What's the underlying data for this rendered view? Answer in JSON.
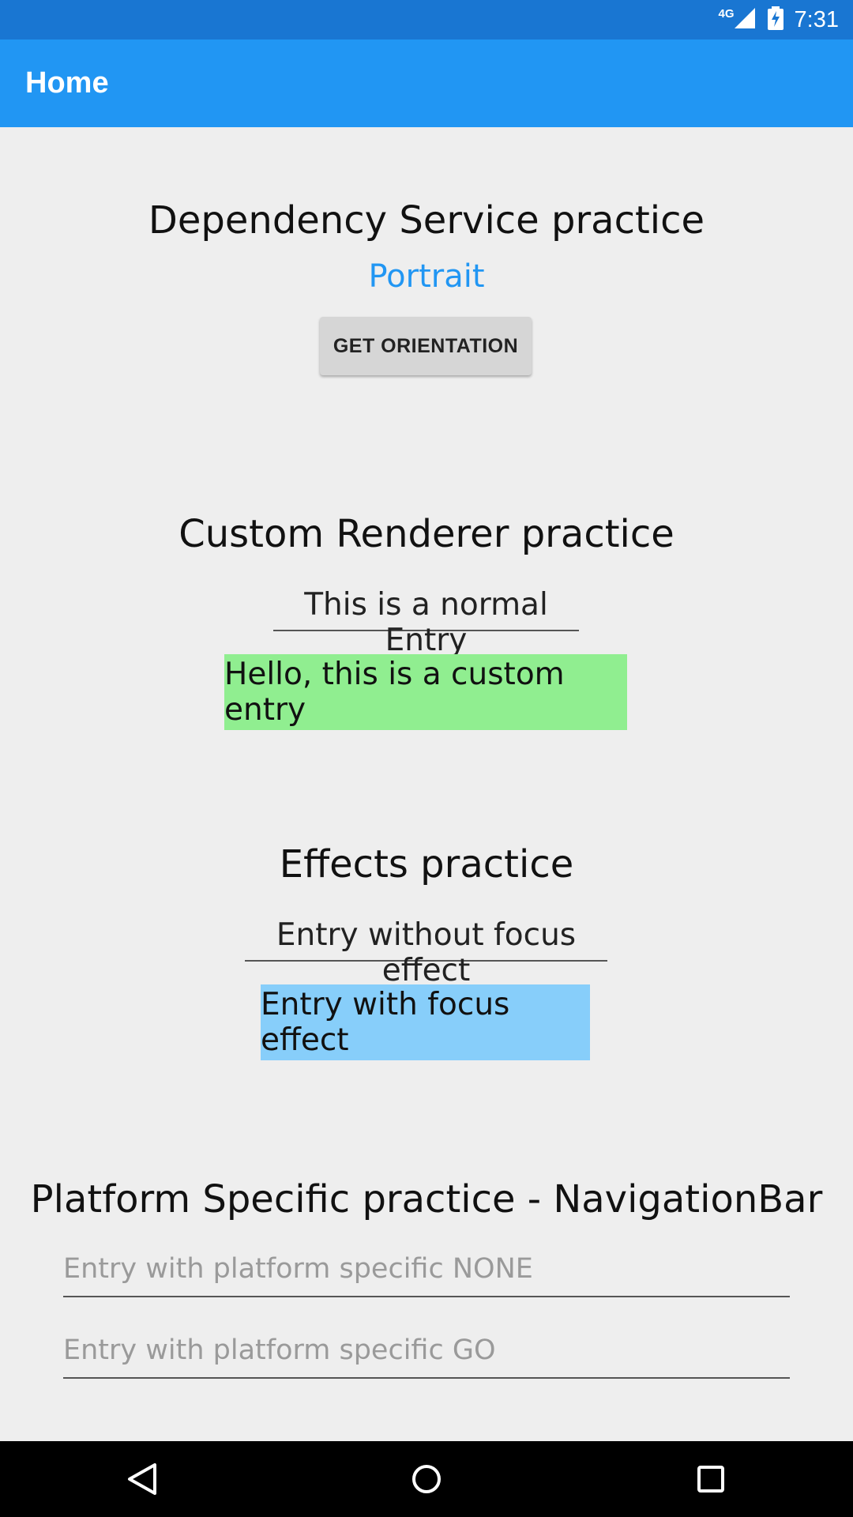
{
  "status_bar": {
    "network": "4G",
    "time": "7:31",
    "icons": [
      "signal-icon",
      "battery-charging-icon"
    ]
  },
  "toolbar": {
    "title": "Home"
  },
  "dependency_section": {
    "heading": "Dependency Service practice",
    "orientation": "Portrait",
    "button_label": "GET ORIENTATION"
  },
  "custom_renderer_section": {
    "heading": "Custom Renderer practice",
    "normal_entry": "This is a normal Entry",
    "custom_entry": "Hello, this is a custom entry"
  },
  "effects_section": {
    "heading": "Effects practice",
    "entry_without_focus": "Entry without focus effect",
    "entry_with_focus": "Entry with focus effect"
  },
  "platform_section": {
    "heading": "Platform Specific practice - NavigationBar",
    "entry_none_placeholder": "Entry with platform specific NONE",
    "entry_go_placeholder": "Entry with platform specific GO"
  },
  "colors": {
    "status_bar": "#1976d2",
    "toolbar": "#2196f3",
    "accent": "#2196f3",
    "custom_entry_bg": "#90ee90",
    "focus_entry_bg": "#87cefa"
  },
  "nav_bar": {
    "icons": [
      "back-icon",
      "home-icon",
      "recents-icon"
    ]
  }
}
